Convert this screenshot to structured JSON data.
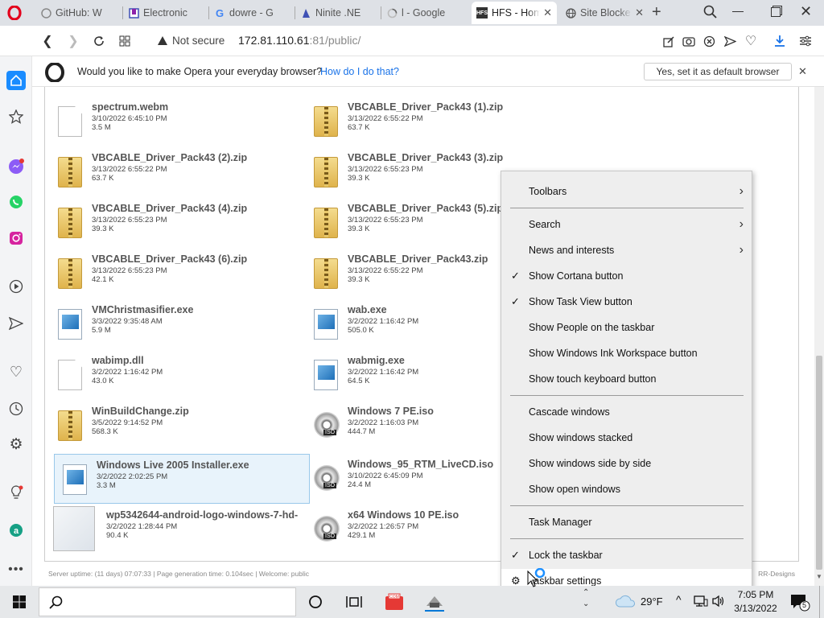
{
  "tabs": [
    {
      "label": "GitHub: W",
      "icon": "github-icon"
    },
    {
      "label": "Electronic",
      "icon": "bookmark-icon"
    },
    {
      "label": "dowre - G",
      "icon": "google-icon"
    },
    {
      "label": "Ninite .NE",
      "icon": "ninite-icon"
    },
    {
      "label": "l - Google",
      "icon": "loading-icon"
    },
    {
      "label": "HFS - Hom",
      "icon": "hfs-icon"
    },
    {
      "label": "Site Blocke",
      "icon": "globe-icon"
    }
  ],
  "address": {
    "security": "Not secure",
    "host": "172.81.110.61",
    "port": ":81",
    "path": "/public/"
  },
  "infobar": {
    "message": "Would you like to make Opera your everyday browser?",
    "link": "How do I do that?",
    "button": "Yes, set it as default browser"
  },
  "files": [
    {
      "name": "spectrum.webm",
      "date": "3/10/2022 6:45:10 PM",
      "size": "3.5 M",
      "type": "doc"
    },
    {
      "name": "VBCABLE_Driver_Pack43 (1).zip",
      "date": "3/13/2022 6:55:22 PM",
      "size": "63.7 K",
      "type": "zip"
    },
    {
      "name": "VBCABLE_Driver_Pack43 (2).zip",
      "date": "3/13/2022 6:55:22 PM",
      "size": "63.7 K",
      "type": "zip"
    },
    {
      "name": "VBCABLE_Driver_Pack43 (3).zip",
      "date": "3/13/2022 6:55:23 PM",
      "size": "39.3 K",
      "type": "zip"
    },
    {
      "name": "VBCABLE_Driver_Pack43 (4).zip",
      "date": "3/13/2022 6:55:23 PM",
      "size": "39.3 K",
      "type": "zip"
    },
    {
      "name": "VBCABLE_Driver_Pack43 (5).zip",
      "date": "3/13/2022 6:55:23 PM",
      "size": "39.3 K",
      "type": "zip"
    },
    {
      "name": "VBCABLE_Driver_Pack43 (6).zip",
      "date": "3/13/2022 6:55:23 PM",
      "size": "42.1 K",
      "type": "zip"
    },
    {
      "name": "VBCABLE_Driver_Pack43.zip",
      "date": "3/13/2022 6:55:22 PM",
      "size": "39.3 K",
      "type": "zip"
    },
    {
      "name": "VMChristmasifier.exe",
      "date": "3/3/2022 9:35:48 AM",
      "size": "5.9 M",
      "type": "exe"
    },
    {
      "name": "wab.exe",
      "date": "3/2/2022 1:16:42 PM",
      "size": "505.0 K",
      "type": "exe"
    },
    {
      "name": "wabimp.dll",
      "date": "3/2/2022 1:16:42 PM",
      "size": "43.0 K",
      "type": "doc"
    },
    {
      "name": "wabmig.exe",
      "date": "3/2/2022 1:16:42 PM",
      "size": "64.5 K",
      "type": "exe"
    },
    {
      "name": "WinBuildChange.zip",
      "date": "3/5/2022 9:14:52 PM",
      "size": "568.3 K",
      "type": "zip"
    },
    {
      "name": "Windows 7 PE.iso",
      "date": "3/2/2022 1:16:03 PM",
      "size": "444.7 M",
      "type": "iso"
    },
    {
      "name": "Windows Live 2005 Installer.exe",
      "date": "3/2/2022 2:02:25 PM",
      "size": "3.3 M",
      "type": "exe"
    },
    {
      "name": "Windows_95_RTM_LiveCD.iso",
      "date": "3/10/2022 6:45:09 PM",
      "size": "24.4 M",
      "type": "iso"
    },
    {
      "name": "wp5342644-android-logo-windows-7-hd-",
      "date": "3/2/2022 1:28:44 PM",
      "size": "90.4 K",
      "type": "img"
    },
    {
      "name": "x64 Windows 10 PE.iso",
      "date": "3/2/2022 1:26:57 PM",
      "size": "429.1 M",
      "type": "iso"
    }
  ],
  "footer": {
    "left": "Server uptime: (11 days) 07:07:33  |  Page generation time: 0.104sec  |  Welcome: public",
    "right": "RR-Designs"
  },
  "context_menu": [
    {
      "label": "Toolbars",
      "check": "",
      "arrow": "›"
    },
    {
      "label": "Search",
      "check": "",
      "arrow": "›"
    },
    {
      "label": "News and interests",
      "check": "",
      "arrow": "›"
    },
    {
      "label": "Show Cortana button",
      "check": "✓",
      "arrow": ""
    },
    {
      "label": "Show Task View button",
      "check": "✓",
      "arrow": ""
    },
    {
      "label": "Show People on the taskbar",
      "check": "",
      "arrow": ""
    },
    {
      "label": "Show Windows Ink Workspace button",
      "check": "",
      "arrow": ""
    },
    {
      "label": "Show touch keyboard button",
      "check": "",
      "arrow": ""
    },
    {
      "label": "Cascade windows",
      "check": "",
      "arrow": ""
    },
    {
      "label": "Show windows stacked",
      "check": "",
      "arrow": ""
    },
    {
      "label": "Show windows side by side",
      "check": "",
      "arrow": ""
    },
    {
      "label": "Show open windows",
      "check": "",
      "arrow": ""
    },
    {
      "label": "Task Manager",
      "check": "",
      "arrow": ""
    },
    {
      "label": "Lock the taskbar",
      "check": "✓",
      "arrow": ""
    },
    {
      "label": "Taskbar settings",
      "check": "⚙",
      "arrow": ""
    }
  ],
  "taskbar": {
    "temperature": "29°F",
    "time": "7:05 PM",
    "date": "3/13/2022",
    "notifications": "5"
  }
}
